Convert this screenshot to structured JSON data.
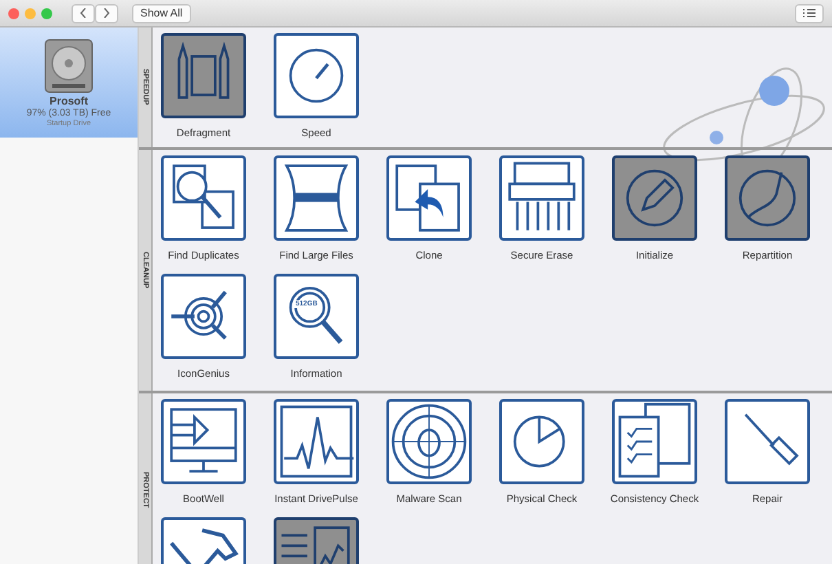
{
  "toolbar": {
    "show_all": "Show All"
  },
  "sidebar": {
    "drives": [
      {
        "name": "Prosoft",
        "free": "97% (3.03 TB) Free",
        "note": "Startup Drive",
        "selected": true
      }
    ]
  },
  "sections": [
    {
      "label": "SPEEDUP",
      "tools": [
        {
          "label": "Defragment",
          "highlighted": true
        },
        {
          "label": "Speed",
          "highlighted": false
        }
      ]
    },
    {
      "label": "CLEANUP",
      "tools": [
        {
          "label": "Find Duplicates",
          "highlighted": false
        },
        {
          "label": "Find Large Files",
          "highlighted": false
        },
        {
          "label": "Clone",
          "highlighted": false
        },
        {
          "label": "Secure Erase",
          "highlighted": false
        },
        {
          "label": "Initialize",
          "highlighted": true
        },
        {
          "label": "Repartition",
          "highlighted": true
        },
        {
          "label": "IconGenius",
          "highlighted": false
        },
        {
          "label": "Information",
          "highlighted": false,
          "badge": "512GB"
        }
      ]
    },
    {
      "label": "PROTECT",
      "tools": [
        {
          "label": "BootWell",
          "highlighted": false
        },
        {
          "label": "Instant DrivePulse",
          "highlighted": false
        },
        {
          "label": "Malware Scan",
          "highlighted": false
        },
        {
          "label": "Physical Check",
          "highlighted": false
        },
        {
          "label": "Consistency Check",
          "highlighted": false
        },
        {
          "label": "Repair",
          "highlighted": false
        },
        {
          "highlighted": false
        },
        {
          "highlighted": true
        }
      ]
    }
  ]
}
